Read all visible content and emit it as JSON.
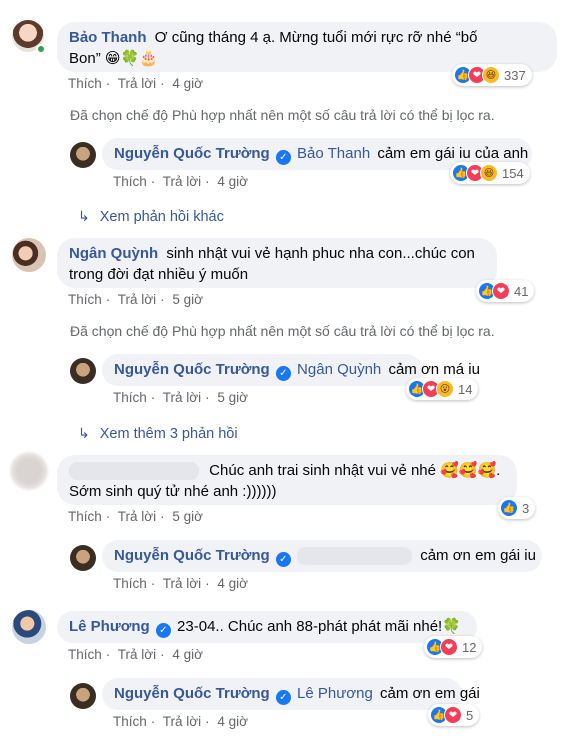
{
  "actions": {
    "like": "Thích",
    "reply": "Trả lời",
    "dot": "·"
  },
  "notice": "Đã chọn chế độ Phù hợp nhất nên một số câu trả lời có thể bị lọc ra.",
  "comments": [
    {
      "author": "Bảo Thanh",
      "text_line1": "Ơ cũng tháng 4 ạ. Mừng tuổi mới rực rỡ nhé “bố",
      "text_line2": "Bon” 😁🍀🎂",
      "time": "4 giờ",
      "reaction_count": "337",
      "reactions": [
        "like",
        "love",
        "haha"
      ],
      "reply": {
        "author": "Nguyễn Quốc Trường",
        "tag": "Bảo Thanh",
        "text": "cảm em gái iu của anh",
        "time": "4 giờ",
        "reaction_count": "154",
        "reactions": [
          "like",
          "love",
          "haha"
        ]
      },
      "more_replies": "Xem phản hồi khác"
    },
    {
      "author": "Ngân Quỳnh",
      "text_line1": "sinh nhật vui vẻ hạnh phuc nha con...chúc con",
      "text_line2": "trong đời đạt nhiều ý muốn",
      "time": "5 giờ",
      "reaction_count": "41",
      "reactions": [
        "like",
        "love"
      ],
      "reply": {
        "author": "Nguyễn Quốc Trường",
        "tag": "Ngân Quỳnh",
        "text": "cảm ơn má iu",
        "time": "5 giờ",
        "reaction_count": "14",
        "reactions": [
          "like",
          "love",
          "wow"
        ]
      },
      "more_replies": "Xem thêm 3 phản hồi"
    },
    {
      "author": "",
      "text_line1": "Chúc anh trai sinh nhật vui vẻ nhé 🥰🥰🥰.",
      "text_line2": "Sớm sinh quý tử nhé anh :))))))",
      "time": "5 giờ",
      "reaction_count": "3",
      "reactions": [
        "like"
      ],
      "reply": {
        "author": "Nguyễn Quốc Trường",
        "tag": "",
        "text": "cảm ơn em gái iu",
        "time": "4 giờ"
      }
    },
    {
      "author": "Lê Phương",
      "text_line1": "23-04.. Chúc anh 88-phát phát mãi nhé!🍀",
      "time": "4 giờ",
      "reaction_count": "12",
      "reactions": [
        "like",
        "love"
      ],
      "reply": {
        "author": "Nguyễn Quốc Trường",
        "tag": "Lê Phương",
        "text": "cảm ơn em gái",
        "time": "4 giờ",
        "reaction_count": "5",
        "reactions": [
          "like",
          "love"
        ]
      }
    }
  ],
  "colors": {
    "name": "#385898",
    "bubble": "#f0f2f5",
    "meta": "#65676b",
    "like": "#1877f2",
    "love": "#f33e58",
    "haha": "#f7b928"
  },
  "icons": {
    "verified": "verified-check-icon",
    "reply_arrow": "reply-arrow-icon"
  }
}
